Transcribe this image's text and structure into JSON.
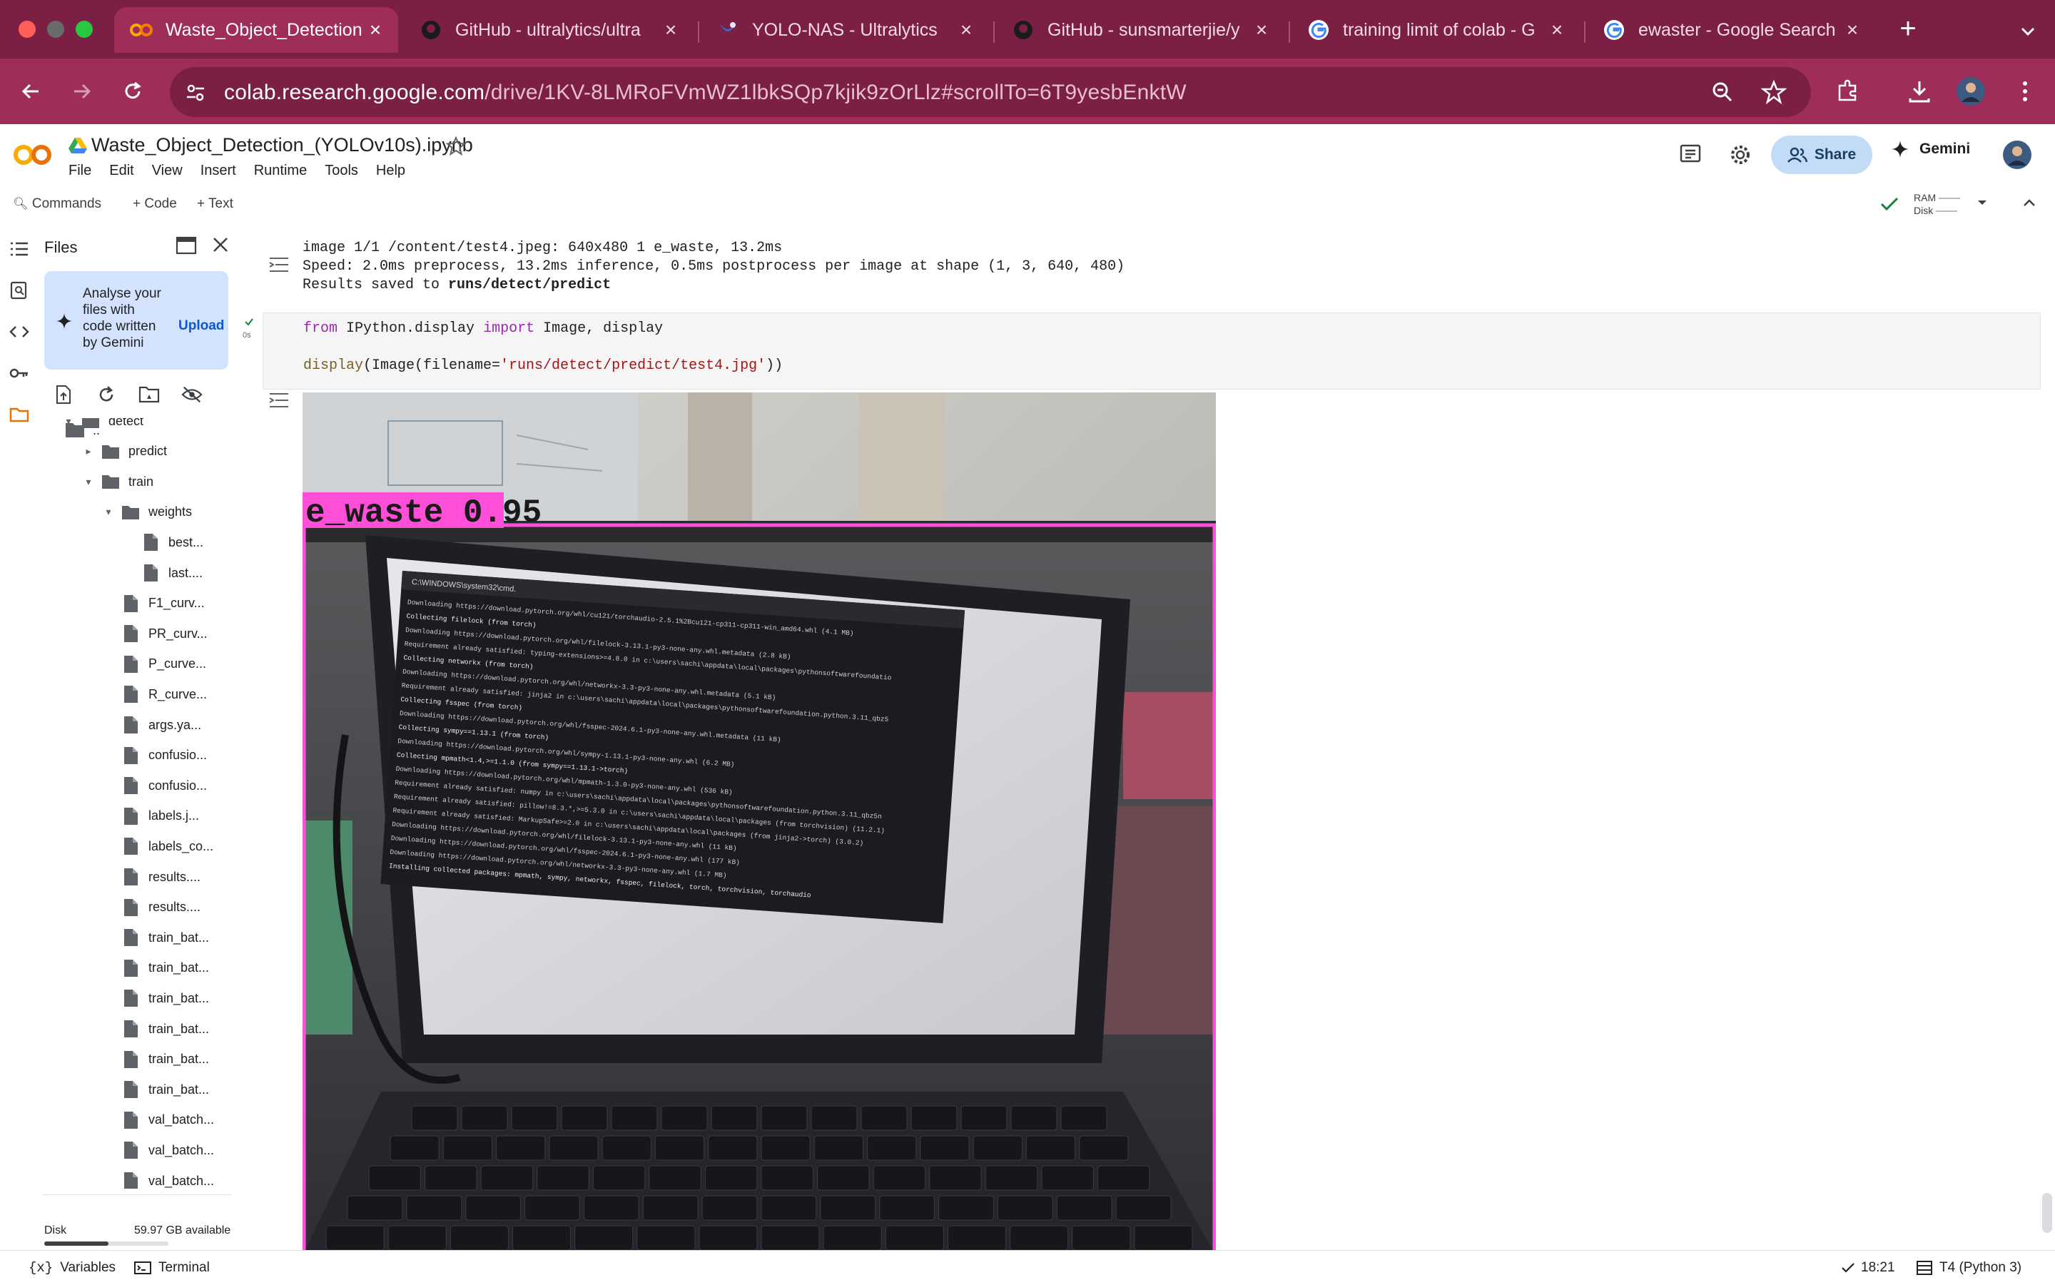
{
  "browser": {
    "tabs": [
      {
        "title": "Waste_Object_Detection",
        "icon": "colab-icon",
        "active": true
      },
      {
        "title": "GitHub - ultralytics/ultra",
        "icon": "github-icon",
        "active": false
      },
      {
        "title": "YOLO-NAS - Ultralytics",
        "icon": "ultralytics-icon",
        "active": false
      },
      {
        "title": "GitHub - sunsmarterjie/y",
        "icon": "github-icon",
        "active": false
      },
      {
        "title": "training limit of colab - G",
        "icon": "google-icon",
        "active": false
      },
      {
        "title": "ewaster - Google Search",
        "icon": "google-icon",
        "active": false
      }
    ],
    "new_tab": "+",
    "address": {
      "domain": "colab.research.google.com",
      "path": "/drive/1KV-8LMRoFVmWZ1lbkSQp7kjik9zOrLlz#scrollTo=6T9yesbEnktW"
    },
    "colors": {
      "tabstrip": "#7b1f44",
      "toolbar": "#9e2d5a"
    }
  },
  "colab": {
    "logo": "CO",
    "notebook_title": "Waste_Object_Detection_(YOLOv10s).ipynb",
    "menu": [
      "File",
      "Edit",
      "View",
      "Insert",
      "Runtime",
      "Tools",
      "Help"
    ],
    "share_label": "Share",
    "gemini_label": "Gemini",
    "toolbar": {
      "commands": "Commands",
      "code": "Code",
      "text": "Text",
      "ram": "RAM",
      "disk": "Disk"
    }
  },
  "files_panel": {
    "title": "Files",
    "gemini_card_text": "Analyse your files with code written by Gemini",
    "upload_label": "Upload",
    "parent_label": "..",
    "tree": [
      {
        "name": "detect",
        "type": "folder",
        "depth": 1,
        "expanded": true
      },
      {
        "name": "predict",
        "type": "folder",
        "depth": 2,
        "expanded": false
      },
      {
        "name": "train",
        "type": "folder",
        "depth": 2,
        "expanded": true
      },
      {
        "name": "weights",
        "type": "folder",
        "depth": 3,
        "expanded": true
      },
      {
        "name": "best...",
        "type": "file",
        "depth": 4
      },
      {
        "name": "last....",
        "type": "file",
        "depth": 4
      },
      {
        "name": "F1_curv...",
        "type": "file",
        "depth": 3
      },
      {
        "name": "PR_curv...",
        "type": "file",
        "depth": 3
      },
      {
        "name": "P_curve...",
        "type": "file",
        "depth": 3
      },
      {
        "name": "R_curve...",
        "type": "file",
        "depth": 3
      },
      {
        "name": "args.ya...",
        "type": "file",
        "depth": 3
      },
      {
        "name": "confusio...",
        "type": "file",
        "depth": 3
      },
      {
        "name": "confusio...",
        "type": "file",
        "depth": 3
      },
      {
        "name": "labels.j...",
        "type": "file",
        "depth": 3
      },
      {
        "name": "labels_co...",
        "type": "file",
        "depth": 3
      },
      {
        "name": "results....",
        "type": "file",
        "depth": 3
      },
      {
        "name": "results....",
        "type": "file",
        "depth": 3
      },
      {
        "name": "train_bat...",
        "type": "file",
        "depth": 3
      },
      {
        "name": "train_bat...",
        "type": "file",
        "depth": 3
      },
      {
        "name": "train_bat...",
        "type": "file",
        "depth": 3
      },
      {
        "name": "train_bat...",
        "type": "file",
        "depth": 3
      },
      {
        "name": "train_bat...",
        "type": "file",
        "depth": 3
      },
      {
        "name": "train_bat...",
        "type": "file",
        "depth": 3
      },
      {
        "name": "val_batch...",
        "type": "file",
        "depth": 3
      },
      {
        "name": "val_batch...",
        "type": "file",
        "depth": 3
      },
      {
        "name": "val_batch...",
        "type": "file",
        "depth": 3
      }
    ],
    "disk_label": "Disk",
    "disk_available": "59.97 GB available",
    "disk_used_fraction": 0.52
  },
  "notebook": {
    "output_lines": [
      "image 1/1 /content/test4.jpeg: 640x480 1 e_waste, 13.2ms",
      "Speed: 2.0ms preprocess, 13.2ms inference, 0.5ms postprocess per image at shape (1, 3, 640, 480)",
      "Results saved to "
    ],
    "output_bold": "runs/detect/predict",
    "cell_exec_time": "0s",
    "code": {
      "line1_kw1": "from",
      "line1_mod": " IPython.display ",
      "line1_kw2": "import",
      "line1_rest": " Image, display",
      "line2_fn": "display",
      "line2_a": "(Image(filename=",
      "line2_str": "'runs/detect/predict/test4.jpg'",
      "line2_b": "))"
    },
    "detection": {
      "label": "e_waste 0.95",
      "box_color": "#ff4fd8",
      "terminal_title": "C:\\WINDOWS\\system32\\cmd.",
      "terminal_lines": [
        "Downloading https://download.pytorch.org/whl/cu121/torchaudio-2.5.1%2Bcu121-cp311-cp311-win_amd64.whl (4.1 MB)",
        "Collecting filelock (from torch)",
        "  Downloading https://download.pytorch.org/whl/filelock-3.13.1-py3-none-any.whl.metadata (2.8 kB)",
        "Requirement already satisfied: typing-extensions>=4.8.0 in c:\\users\\sachi\\appdata\\local\\packages\\pythonsoftwarefoundatio",
        "Collecting networkx (from torch)",
        "  Downloading https://download.pytorch.org/whl/networkx-3.3-py3-none-any.whl.metadata (5.1 kB)",
        "Requirement already satisfied: jinja2 in c:\\users\\sachi\\appdata\\local\\packages\\pythonsoftwarefoundation.python.3.11_qbz5",
        "Collecting fsspec (from torch)",
        "  Downloading https://download.pytorch.org/whl/fsspec-2024.6.1-py3-none-any.whl.metadata (11 kB)",
        "Collecting sympy==1.13.1 (from torch)",
        "  Downloading https://download.pytorch.org/whl/sympy-1.13.1-py3-none-any.whl (6.2 MB)",
        "Collecting mpmath<1.4,>=1.1.0 (from sympy==1.13.1->torch)",
        "  Downloading https://download.pytorch.org/whl/mpmath-1.3.0-py3-none-any.whl (536 kB)",
        "Requirement already satisfied: numpy in c:\\users\\sachi\\appdata\\local\\packages\\pythonsoftwarefoundation.python.3.11_qbz5n",
        "Requirement already satisfied: pillow!=8.3.*,>=5.3.0 in c:\\users\\sachi\\appdata\\local\\packages (from torchvision) (11.2.1)",
        "Requirement already satisfied: MarkupSafe>=2.0 in c:\\users\\sachi\\appdata\\local\\packages (from jinja2->torch) (3.0.2)",
        "Downloading https://download.pytorch.org/whl/filelock-3.13.1-py3-none-any.whl (11 kB)",
        "Downloading https://download.pytorch.org/whl/fsspec-2024.6.1-py3-none-any.whl (177 kB)",
        "Downloading https://download.pytorch.org/whl/networkx-3.3-py3-none-any.whl (1.7 MB)",
        "Installing collected packages: mpmath, sympy, networkx, fsspec, filelock, torch, torchvision, torchaudio"
      ]
    }
  },
  "statusbar": {
    "variables": "Variables",
    "terminal": "Terminal",
    "time": "18:21",
    "runtime": "T4 (Python 3)"
  }
}
